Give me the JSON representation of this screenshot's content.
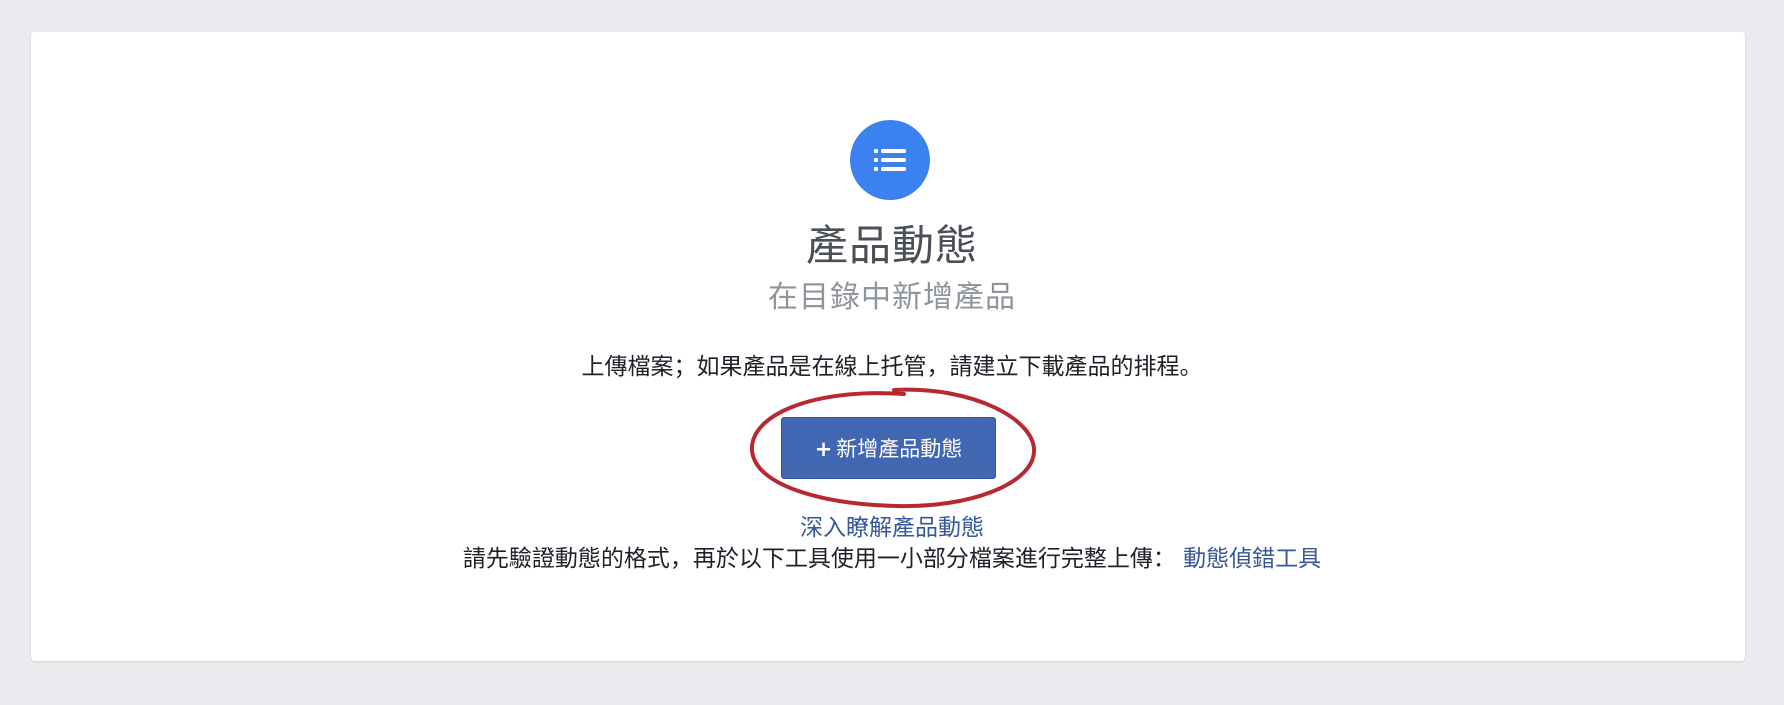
{
  "header": {
    "icon": "list-icon",
    "title": "產品動態",
    "subtitle": "在目錄中新增產品"
  },
  "main": {
    "description": "上傳檔案；如果產品是在線上托管，請建立下載產品的排程。",
    "add_button": {
      "icon": "plus-icon",
      "plus": "+",
      "label": "新增產品動態"
    },
    "learn_more_link": "深入瞭解產品動態",
    "validate_text": "請先驗證動態的格式，再於以下工具使用一小部分檔案進行完整上傳：",
    "debug_tool_link": "動態偵錯工具"
  },
  "colors": {
    "page_background": "#e9ebee",
    "card_background": "#ffffff",
    "icon_circle": "#3b82f0",
    "button_primary": "#4267b2",
    "link": "#365899",
    "annotation": "#b8292f"
  }
}
